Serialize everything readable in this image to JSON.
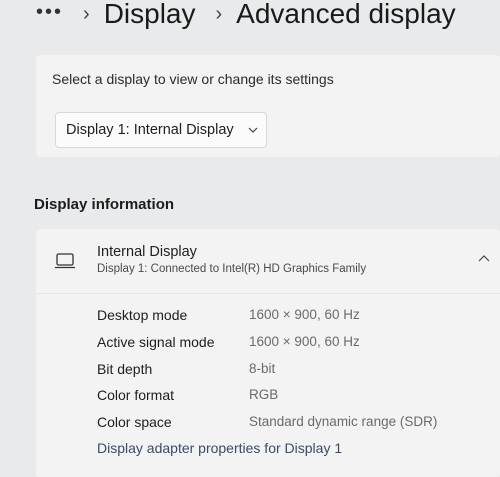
{
  "breadcrumb": {
    "more": "•••",
    "items": [
      "Display",
      "Advanced display"
    ]
  },
  "select_section": {
    "label": "Select a display to view or change its settings",
    "dropdown_value": "Display 1: Internal Display"
  },
  "display_information": {
    "title": "Display information",
    "display_name": "Internal Display",
    "display_subtitle": "Display 1: Connected to Intel(R) HD Graphics Family",
    "rows": [
      {
        "key": "Desktop mode",
        "value": "1600 × 900, 60 Hz"
      },
      {
        "key": "Active signal mode",
        "value": "1600 × 900, 60 Hz"
      },
      {
        "key": "Bit depth",
        "value": "8-bit"
      },
      {
        "key": "Color format",
        "value": "RGB"
      },
      {
        "key": "Color space",
        "value": "Standard dynamic range (SDR)"
      }
    ],
    "adapter_link": "Display adapter properties for Display 1"
  },
  "icons": {
    "more": "more-icon",
    "separator": "chevron-right-icon",
    "dropdown": "chevron-down-icon",
    "monitor": "monitor-icon",
    "collapse": "chevron-up-icon"
  },
  "colors": {
    "background": "#e9eaeb",
    "card": "#f3f3f4",
    "link": "#3b4a66"
  }
}
